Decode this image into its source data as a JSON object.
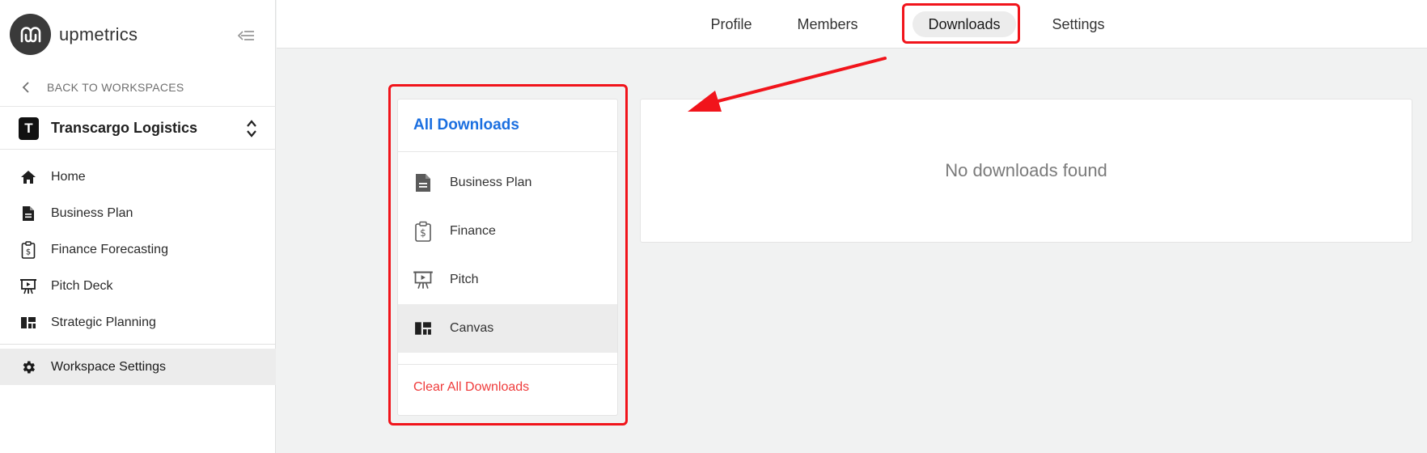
{
  "app": {
    "brand_name": "upmetrics"
  },
  "sidebar": {
    "back_label": "BACK TO WORKSPACES",
    "workspace": {
      "initial": "T",
      "name": "Transcargo Logistics"
    },
    "items": [
      {
        "label": "Home",
        "icon": "home-icon"
      },
      {
        "label": "Business Plan",
        "icon": "document-icon"
      },
      {
        "label": "Finance Forecasting",
        "icon": "finance-clipboard-icon"
      },
      {
        "label": "Pitch Deck",
        "icon": "presentation-icon"
      },
      {
        "label": "Strategic Planning",
        "icon": "dashboard-grid-icon"
      }
    ],
    "active_item": {
      "label": "Workspace Settings",
      "icon": "gear-icon"
    }
  },
  "topbar": {
    "tabs": [
      {
        "label": "Profile"
      },
      {
        "label": "Members"
      },
      {
        "label": "Downloads",
        "active": true
      },
      {
        "label": "Settings"
      }
    ]
  },
  "downloads": {
    "title": "All Downloads",
    "items": [
      {
        "label": "Business Plan",
        "icon": "document-icon"
      },
      {
        "label": "Finance",
        "icon": "finance-clipboard-icon"
      },
      {
        "label": "Pitch",
        "icon": "presentation-icon"
      },
      {
        "label": "Canvas",
        "icon": "dashboard-grid-icon",
        "selected": true
      }
    ],
    "clear_label": "Clear All Downloads"
  },
  "content": {
    "empty_message": "No downloads found"
  },
  "colors": {
    "accent_blue": "#1b6fe0",
    "danger_red": "#ef3b3b",
    "highlight_red": "#f1141b"
  }
}
